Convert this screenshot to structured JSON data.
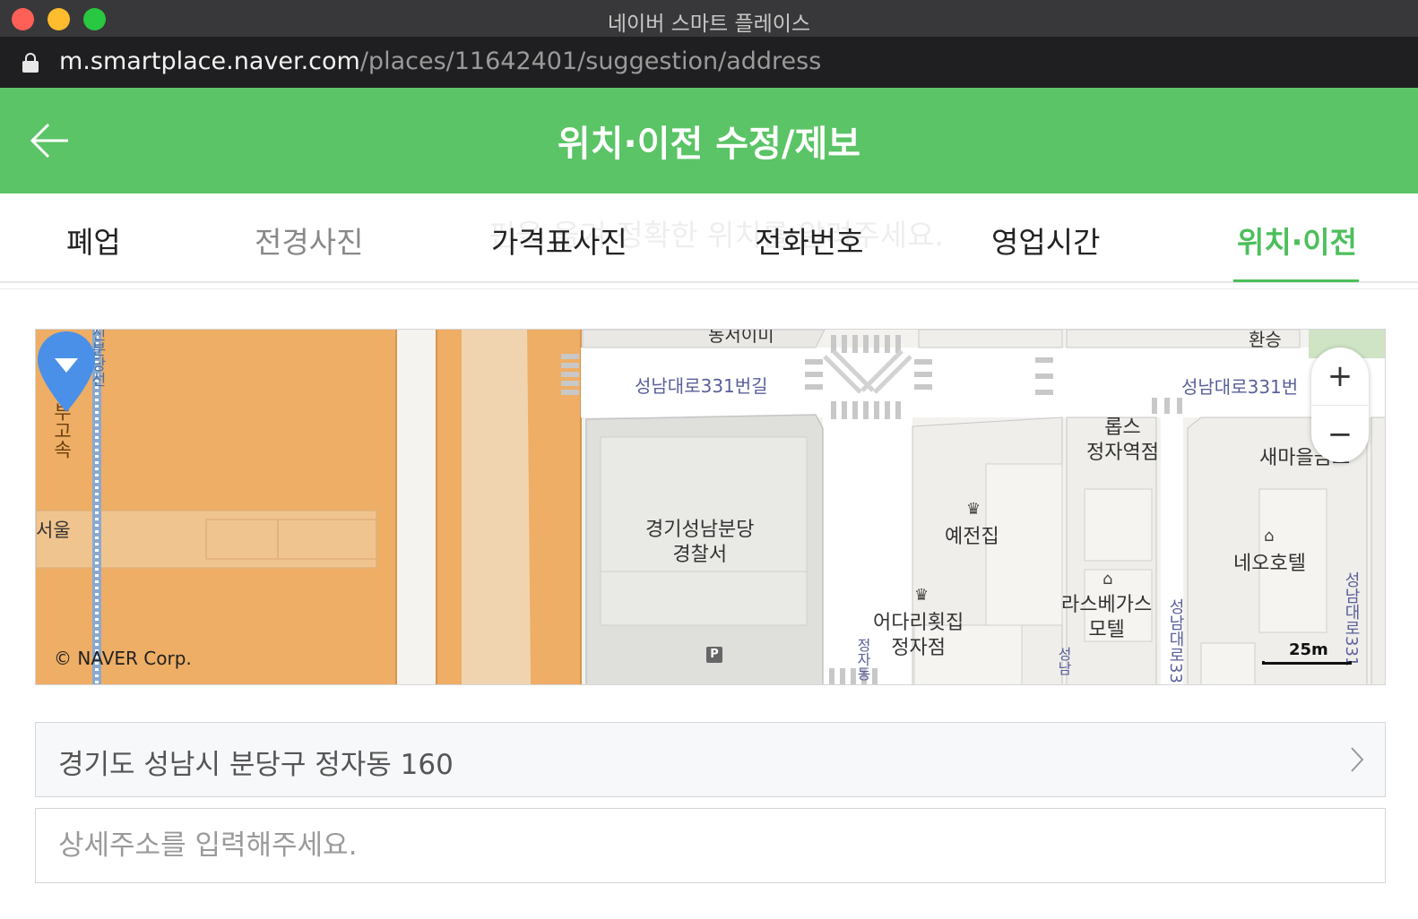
{
  "window": {
    "title": "네이버 스마트 플레이스",
    "url_host": "m.smartplace.naver.com",
    "url_path": "/places/11642401/suggestion/address"
  },
  "header": {
    "title": "위치·이전 수정/제보",
    "back_icon": "arrow-left-icon",
    "background": "#5bc466"
  },
  "tabs": [
    {
      "label": "폐업",
      "active": false
    },
    {
      "label": "전경사진",
      "active": false
    },
    {
      "label": "가격표사진",
      "active": false
    },
    {
      "label": "전화번호",
      "active": false
    },
    {
      "label": "영업시간",
      "active": false
    },
    {
      "label": "위치·이전",
      "active": true
    }
  ],
  "hint_text": "핀을 옮겨 정확한 위치를 알려주세요.",
  "map": {
    "labels": {
      "police": "경기성남분당\n경찰서",
      "yejeonjip": "예전집",
      "eodari": "어다리횟집\n정자점",
      "lasvegas": "라스베가스\n모텔",
      "neo": "네오호텔",
      "lotte": "롭스\n정자역점",
      "saemaeul": "새마을금고",
      "transfer": "환승",
      "seoul": "서울",
      "top_cut": "동서이미"
    },
    "road_labels": {
      "road1": "성남대로331번길",
      "road2": "성남대로331번",
      "highway": "경부고속",
      "rail": "신분당선",
      "vert1": "성남대로331번길",
      "vert2": "성남대로331",
      "vert3": "정자동",
      "vert4": "성남"
    },
    "copyright": "© NAVER Corp.",
    "scale": "25m",
    "zoom_in": "+",
    "zoom_out": "−",
    "parking": "P"
  },
  "address": {
    "value": "경기도 성남시 분당구 정자동 160",
    "detail_placeholder": "상세주소를 입력해주세요."
  },
  "colors": {
    "accent": "#4cbf5a",
    "highway": "#eeae65",
    "pin": "#4a90e8"
  }
}
